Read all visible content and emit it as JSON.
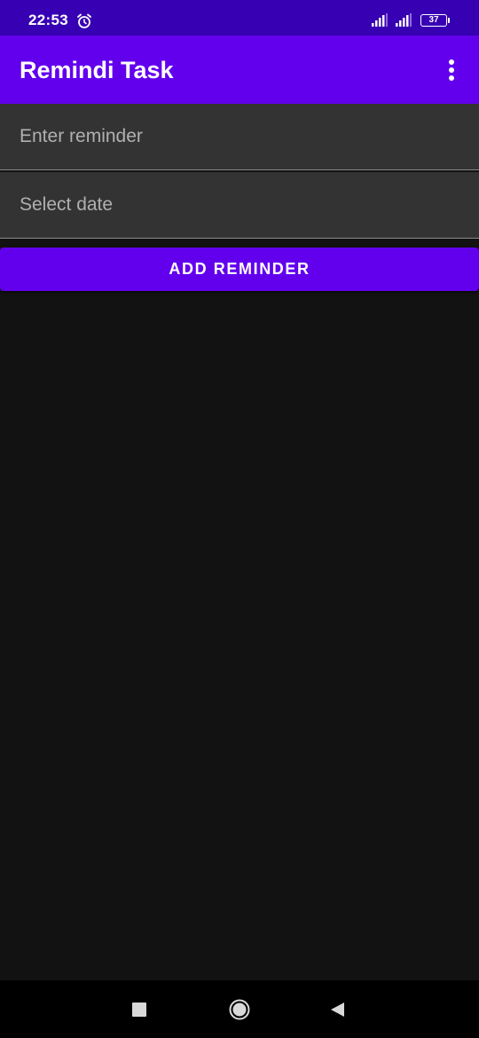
{
  "status_bar": {
    "time": "22:53",
    "battery_level": "37",
    "icons": [
      "alarm-icon",
      "signal-icon",
      "signal-icon",
      "battery-icon"
    ]
  },
  "app_bar": {
    "title": "Remindi Task",
    "overflow_icon": "more-vert-icon"
  },
  "form": {
    "reminder_placeholder": "Enter reminder",
    "reminder_value": "",
    "date_placeholder": "Select date",
    "date_value": "",
    "add_button_label": "ADD REMINDER"
  },
  "nav_bar": {
    "icons": [
      "recents-square-icon",
      "home-circle-icon",
      "back-triangle-icon"
    ]
  },
  "colors": {
    "status_bar": "#3700b3",
    "primary": "#6200ee",
    "background": "#121212",
    "field_background": "#333333"
  }
}
